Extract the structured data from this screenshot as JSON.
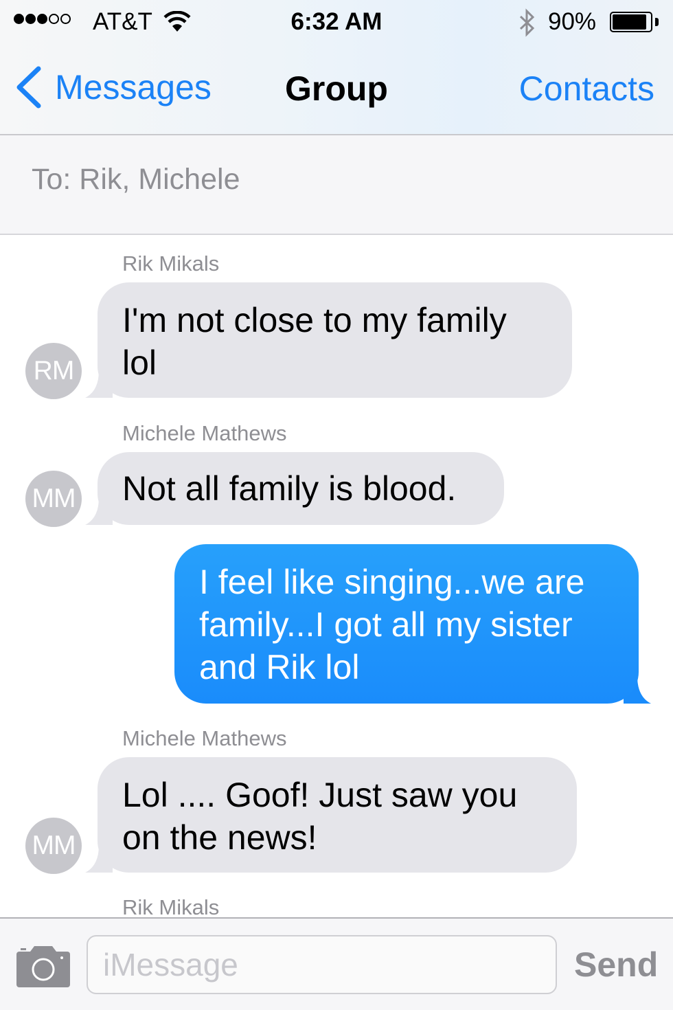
{
  "status_bar": {
    "signal_bars_filled": 3,
    "signal_bars_total": 5,
    "carrier": "AT&T",
    "wifi_icon": "wifi-icon",
    "time": "6:32 AM",
    "bluetooth_icon": "bluetooth-icon",
    "battery_percent": "90%",
    "battery_level": 0.9
  },
  "nav": {
    "back_label": "Messages",
    "title": "Group",
    "right_label": "Contacts"
  },
  "to_field": {
    "text": "To: Rik, Michele"
  },
  "messages": [
    {
      "direction": "incoming",
      "sender": "Rik Mikals",
      "initials": "RM",
      "lines": [
        "I'm not close to my family",
        "lol"
      ]
    },
    {
      "direction": "incoming",
      "sender": "Michele Mathews",
      "initials": "MM",
      "lines": [
        "Not all family is blood."
      ]
    },
    {
      "direction": "outgoing",
      "lines": [
        "I feel like singing...we are",
        "family...I got all my sister",
        "and Rik lol"
      ]
    },
    {
      "direction": "incoming",
      "sender": "Michele Mathews",
      "initials": "MM",
      "lines": [
        "Lol .... Goof! Just saw you",
        "on the news!"
      ]
    },
    {
      "direction": "incoming",
      "sender": "Rik Mikals",
      "partial": true
    }
  ],
  "input_bar": {
    "camera_icon": "camera-icon",
    "placeholder": "iMessage",
    "value": "",
    "send_label": "Send"
  },
  "colors": {
    "accent": "#1b82f6",
    "incoming_bubble": "#e5e5ea",
    "outgoing_bubble": "#1a8cfb",
    "avatar": "#c7c7cc",
    "secondary_text": "#8e8e93"
  }
}
